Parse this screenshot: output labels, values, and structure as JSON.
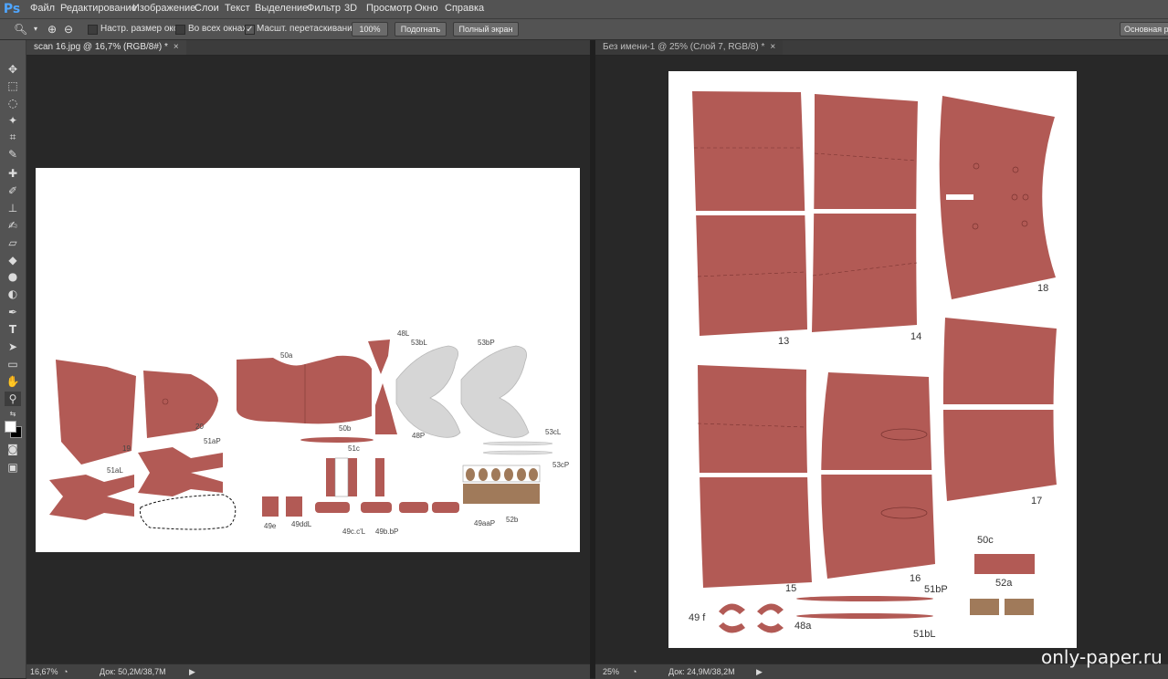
{
  "app": {
    "logo": "Ps",
    "accent": "#4fa6ff"
  },
  "menu": [
    "Файл",
    "Редактирование",
    "Изображение",
    "Слои",
    "Текст",
    "Выделение",
    "Фильтр",
    "3D",
    "Просмотр",
    "Окно",
    "Справка"
  ],
  "options": {
    "tool_icon": "zoom-icon",
    "resize_windows_label": "Настр. размер окон",
    "all_windows_label": "Во всех окнах",
    "scrubby_zoom_label": "Масшт. перетаскиванием",
    "scrubby_checked": "✓",
    "btn_100": "100%",
    "btn_fit": "Подогнать",
    "btn_fullscreen": "Полный экран",
    "workspace": "Основная ра"
  },
  "tools": [
    "move-icon",
    "marquee-icon",
    "lasso-icon",
    "magic-wand-icon",
    "crop-icon",
    "eyedropper-icon",
    "healing-brush-icon",
    "brush-icon",
    "clone-stamp-icon",
    "history-brush-icon",
    "eraser-icon",
    "paint-bucket-icon",
    "blur-icon",
    "dodge-icon",
    "pen-icon",
    "type-icon",
    "path-select-icon",
    "shape-icon",
    "hand-icon",
    "zoom-icon"
  ],
  "doc_left": {
    "tab": "scan 16.jpg @ 16,7% (RGB/8#) *",
    "close": "×",
    "zoom": "16,67%",
    "doc_size": "Док: 50,2M/38,7M",
    "labels": {
      "l50a": "50a",
      "l48L": "48L",
      "l53bL": "53bL",
      "l53bP": "53bP",
      "l20": "20",
      "l19": "19",
      "l50b": "50b",
      "l48P": "48P",
      "l51aP": "51aP",
      "l51c": "51c",
      "l53cL": "53cL",
      "l53cP": "53cP",
      "l51aL": "51aL",
      "l49e": "49e",
      "l49ddL": "49ddL",
      "l49ccL": "49c.c'L",
      "l49bbP": "49b.bP",
      "l49aaP": "49aaP",
      "l52b": "52b"
    }
  },
  "doc_right": {
    "tab": "Без имени-1 @ 25% (Слой 7, RGB/8) *",
    "close": "×",
    "zoom": "25%",
    "doc_size": "Док: 24,9M/38,2M",
    "labels": {
      "l13": "13",
      "l14": "14",
      "l18": "18",
      "l15": "15",
      "l16": "16",
      "l17": "17",
      "l50c": "50c",
      "l52a": "52a",
      "l51bP": "51bP",
      "l51bL": "51bL",
      "l49f": "49 f",
      "l48a": "48a"
    }
  },
  "colors": {
    "part": "#b25a55",
    "gray_part": "#d4d4d4",
    "brown_strip": "#a07a5a"
  },
  "watermark": "only-paper.ru"
}
